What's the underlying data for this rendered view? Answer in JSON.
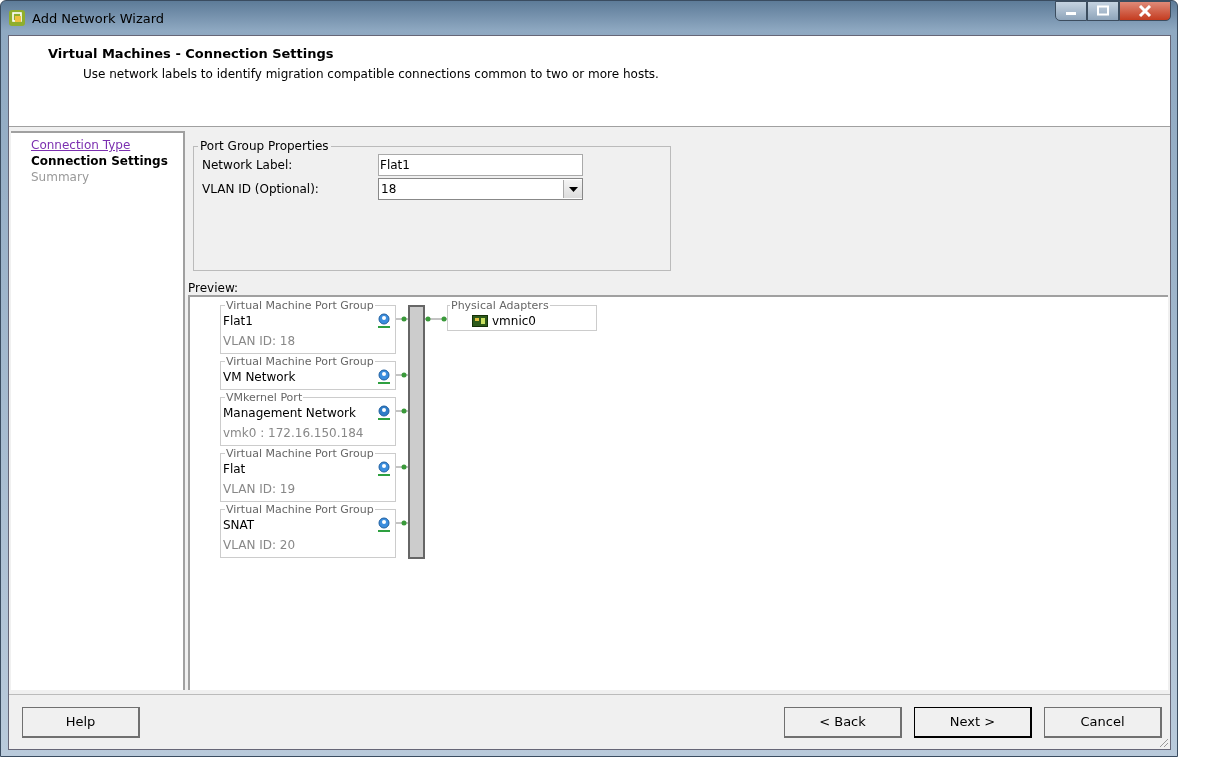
{
  "window": {
    "title": "Add Network Wizard"
  },
  "header": {
    "title": "Virtual Machines - Connection Settings",
    "description": "Use network labels to identify migration compatible connections common to two or more hosts."
  },
  "steps": [
    {
      "label": "Connection Type",
      "selected": false,
      "visited": true
    },
    {
      "label": "Connection Settings",
      "selected": true,
      "visited": false
    },
    {
      "label": "Summary",
      "selected": false,
      "visited": false
    }
  ],
  "port_group_properties": {
    "title": "Port Group Properties",
    "network_label": {
      "label": "Network Label:",
      "value": "Flat1"
    },
    "vlan_id": {
      "label": "VLAN ID (Optional):",
      "value": "18"
    }
  },
  "preview": {
    "label": "Preview:",
    "port_groups": [
      {
        "kind": "vm",
        "group": "Virtual Machine Port Group",
        "name": "Flat1",
        "detail": "VLAN ID: 18"
      },
      {
        "kind": "vm",
        "group": "Virtual Machine Port Group",
        "name": "VM Network"
      },
      {
        "kind": "vmkernel",
        "group": "VMkernel Port",
        "name": "Management Network",
        "detail": "vmk0 : 172.16.150.184"
      },
      {
        "kind": "vm",
        "group": "Virtual Machine Port Group",
        "name": "Flat",
        "detail": "VLAN ID: 19"
      },
      {
        "kind": "vm",
        "group": "Virtual Machine Port Group",
        "name": "SNAT",
        "detail": "VLAN ID: 20"
      }
    ],
    "physical_adapters": {
      "title": "Physical Adapters",
      "adapters": [
        "vmnic0"
      ]
    }
  },
  "buttons": [
    {
      "label": "Help",
      "kind": "help"
    },
    {
      "label": "< Back",
      "kind": "nav"
    },
    {
      "label": "Next >",
      "kind": "default"
    },
    {
      "label": "Cancel",
      "kind": "nav"
    }
  ]
}
